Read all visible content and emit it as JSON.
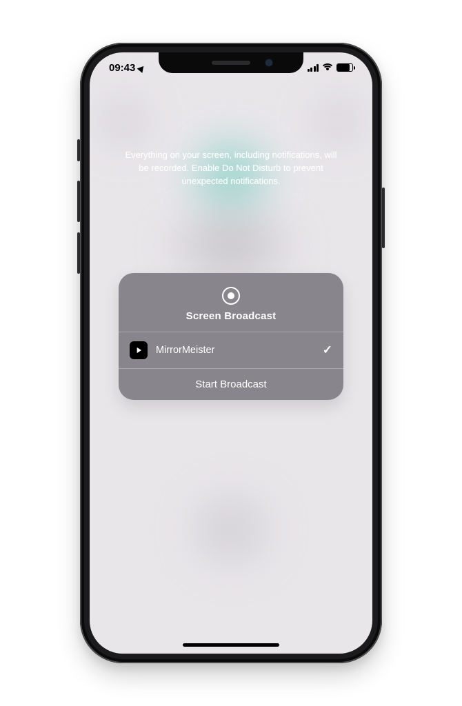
{
  "status": {
    "time": "09:43",
    "location_services": true,
    "signal_bars": 4,
    "wifi": true,
    "battery_pct": 80
  },
  "disclaimer": "Everything on your screen, including notifications, will be recorded. Enable Do Not Disturb to prevent unexpected notifications.",
  "broadcast": {
    "title": "Screen Broadcast",
    "app": {
      "name": "MirrorMeister",
      "selected": true
    },
    "start_label": "Start Broadcast"
  }
}
